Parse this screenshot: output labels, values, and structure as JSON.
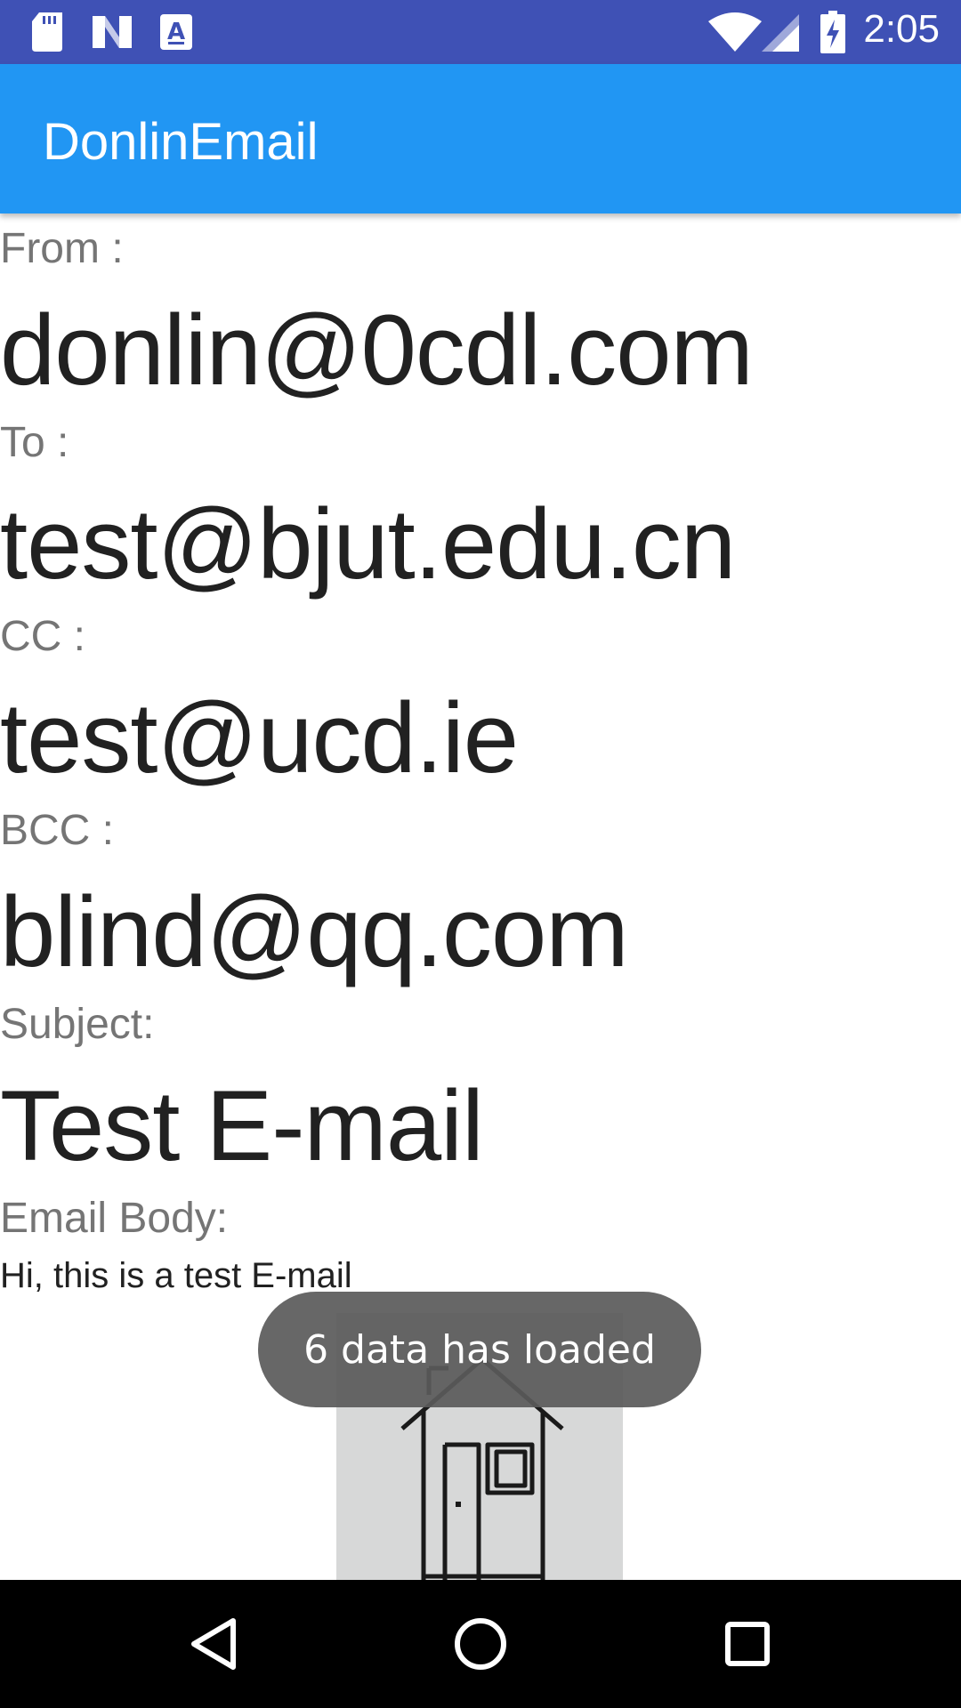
{
  "status_bar": {
    "time": "2:05",
    "icons": [
      "sd-card-icon",
      "n-notification-icon",
      "a-notification-icon",
      "wifi-icon",
      "cell-signal-icon",
      "battery-charging-icon"
    ],
    "color": "#3f51b5"
  },
  "app_bar": {
    "title": "DonlinEmail",
    "color": "#2196f3"
  },
  "email": {
    "from_label": "From :",
    "from_value": "donlin@0cdl.com",
    "to_label": "To :",
    "to_value": "test@bjut.edu.cn",
    "cc_label": "CC :",
    "cc_value": "test@ucd.ie",
    "bcc_label": "BCC :",
    "bcc_value": "blind@qq.com",
    "subject_label": "Subject:",
    "subject_value": "Test E-mail",
    "body_label": "Email Body:",
    "body_value": "Hi, this is a test E-mail"
  },
  "toast": {
    "message": "6 data has loaded"
  },
  "nav_bar": {
    "icons": [
      "back-icon",
      "home-icon",
      "recents-icon"
    ]
  }
}
